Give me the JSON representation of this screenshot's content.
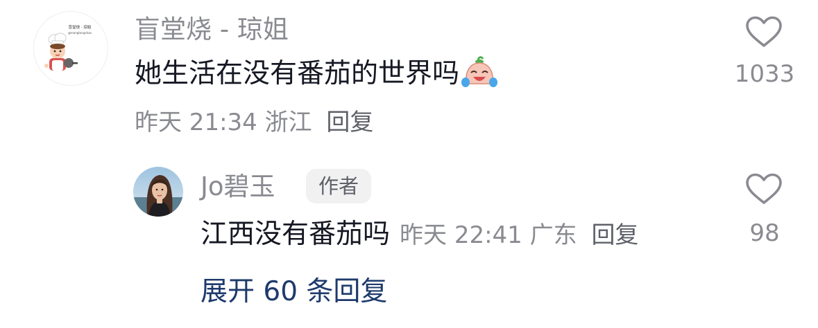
{
  "comment": {
    "username": "盲堂烧 - 琼姐",
    "avatar_text": "盲堂烧 · 琼姐",
    "avatar_subtext": "@mangtangshao",
    "text": "她生活在没有番茄的世界吗",
    "emoji": "crying-laughing-tomato-emoji",
    "time": "昨天 21:34",
    "location": "浙江",
    "reply_label": "回复",
    "likes": "1033"
  },
  "reply": {
    "username": "Jo碧玉",
    "badge": "作者",
    "text": "江西没有番茄吗",
    "time": "昨天 22:41",
    "location": "广东",
    "reply_label": "回复",
    "likes": "98"
  },
  "expand_label": "展开 60 条回复",
  "colors": {
    "meta_gray": "#8a8b91",
    "text_dark": "#161823",
    "link_blue": "#1d3a6b",
    "badge_bg": "#f1f1f2"
  },
  "icons": {
    "like": "heart-outline-icon"
  }
}
